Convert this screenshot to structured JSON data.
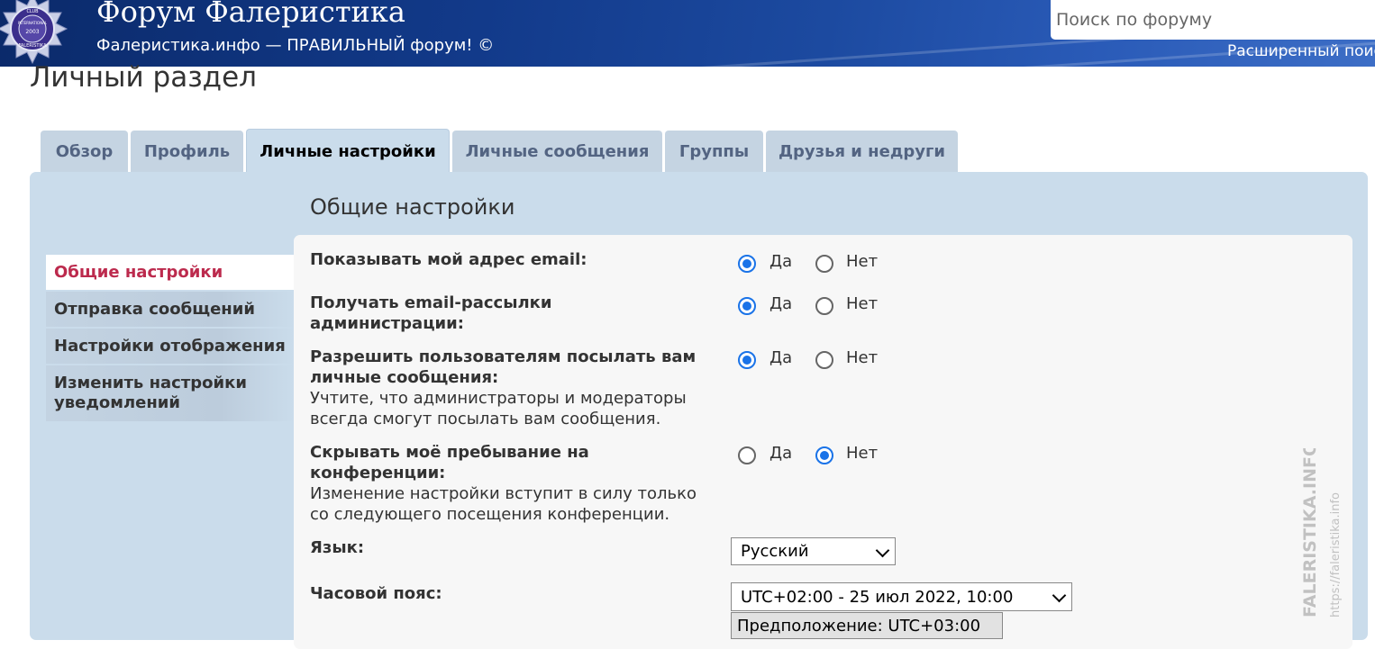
{
  "header": {
    "site_title": "Форум Фалеристика",
    "site_description": "Фалеристика.инфо — ПРАВИЛЬНЫЙ форум! ©",
    "logo_text": [
      "CLUB",
      "INTERNATIONAL",
      "2003",
      "FALERISTIKA"
    ],
    "search_placeholder": "Поиск по форуму",
    "advanced_search": "Расширенный поиск"
  },
  "page_title": "Личный раздел",
  "tabs": [
    {
      "label": "Обзор",
      "active": false
    },
    {
      "label": "Профиль",
      "active": false
    },
    {
      "label": "Личные настройки",
      "active": true
    },
    {
      "label": "Личные сообщения",
      "active": false
    },
    {
      "label": "Группы",
      "active": false
    },
    {
      "label": "Друзья и недруги",
      "active": false
    }
  ],
  "sidebar": {
    "items": [
      {
        "label": "Общие настройки",
        "active": true
      },
      {
        "label": "Отправка сообщений",
        "active": false
      },
      {
        "label": "Настройки отображения",
        "active": false
      },
      {
        "label": "Изменить настройки уведомлений",
        "active": false
      }
    ]
  },
  "section_title": "Общие настройки",
  "options": [
    {
      "label": "Показывать мой адрес email:",
      "description": "",
      "yes": "Да",
      "no": "Нет",
      "value": "yes"
    },
    {
      "label": "Получать email-рассылки администрации:",
      "description": "",
      "yes": "Да",
      "no": "Нет",
      "value": "yes"
    },
    {
      "label": "Разрешить пользователям посылать вам личные сообщения:",
      "description": "Учтите, что администраторы и модераторы всегда смогут посылать вам сообщения.",
      "yes": "Да",
      "no": "Нет",
      "value": "yes"
    },
    {
      "label": "Скрывать моё пребывание на конференции:",
      "description": "Изменение настройки вступит в силу только со следующего посещения конференции.",
      "yes": "Да",
      "no": "Нет",
      "value": "no"
    }
  ],
  "language": {
    "label": "Язык:",
    "value": "Русский"
  },
  "timezone": {
    "label": "Часовой пояс:",
    "value": "UTC+02:00 - 25 июл 2022, 10:00",
    "guess_button": "Предположение: UTC+03:00"
  },
  "watermark": {
    "line1": "FALERISTIKA.INFO",
    "line2": "https://faleristika.info"
  },
  "colors": {
    "header_bg": "#123a8a",
    "panel_bg": "#cadceb",
    "tab_bg": "#c5d4e2",
    "active_nav": "#bc2a4d",
    "radio_checked": "#1a73e8"
  }
}
